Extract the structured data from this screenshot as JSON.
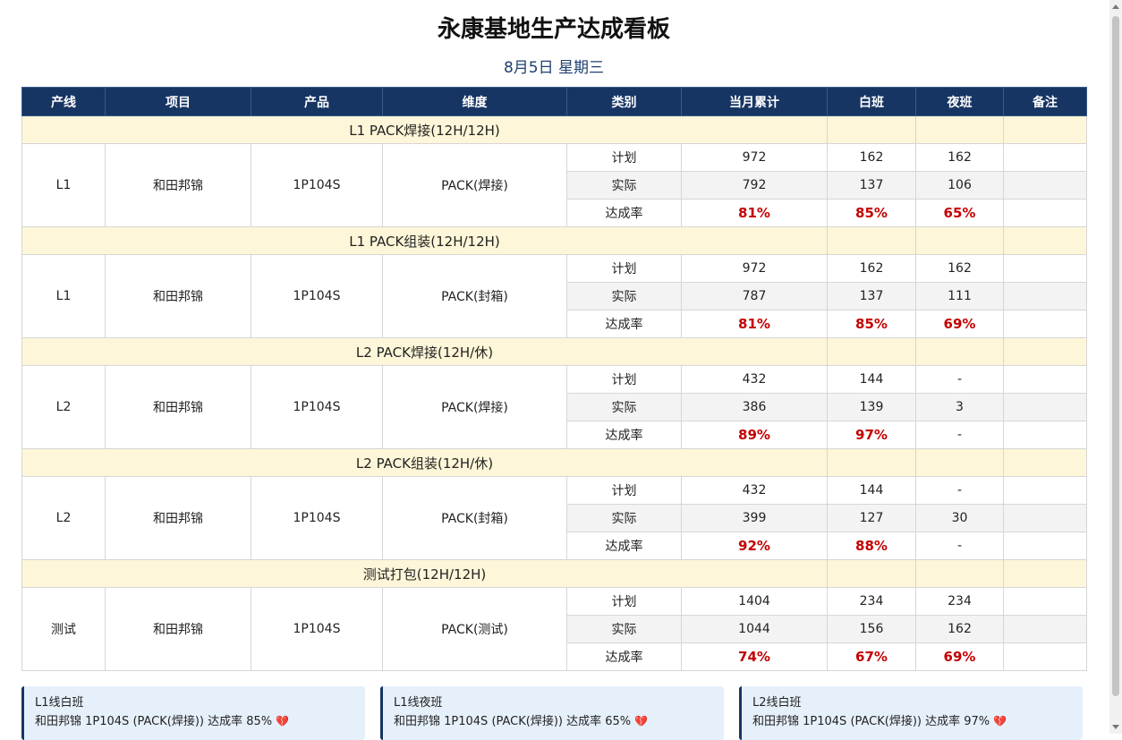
{
  "title": "永康基地生产达成看板",
  "date": "8月5日 星期三",
  "headers": [
    "产线",
    "项目",
    "产品",
    "维度",
    "类别",
    "当月累计",
    "白班",
    "夜班",
    "备注"
  ],
  "sections": [
    {
      "label": "L1 PACK焊接(12H/12H)",
      "line": "L1",
      "project": "和田邦锦",
      "product": "1P104S",
      "dimension": "PACK(焊接)",
      "rows": [
        {
          "category": "计划",
          "month": "972",
          "day": "162",
          "night": "162",
          "note": ""
        },
        {
          "category": "实际",
          "month": "792",
          "day": "137",
          "night": "106",
          "note": ""
        },
        {
          "category": "达成率",
          "month": "81%",
          "day": "85%",
          "night": "65%",
          "note": ""
        }
      ]
    },
    {
      "label": "L1 PACK组装(12H/12H)",
      "line": "L1",
      "project": "和田邦锦",
      "product": "1P104S",
      "dimension": "PACK(封箱)",
      "rows": [
        {
          "category": "计划",
          "month": "972",
          "day": "162",
          "night": "162",
          "note": ""
        },
        {
          "category": "实际",
          "month": "787",
          "day": "137",
          "night": "111",
          "note": ""
        },
        {
          "category": "达成率",
          "month": "81%",
          "day": "85%",
          "night": "69%",
          "note": ""
        }
      ]
    },
    {
      "label": "L2 PACK焊接(12H/休)",
      "line": "L2",
      "project": "和田邦锦",
      "product": "1P104S",
      "dimension": "PACK(焊接)",
      "rows": [
        {
          "category": "计划",
          "month": "432",
          "day": "144",
          "night": "-",
          "note": ""
        },
        {
          "category": "实际",
          "month": "386",
          "day": "139",
          "night": "3",
          "note": ""
        },
        {
          "category": "达成率",
          "month": "89%",
          "day": "97%",
          "night": "-",
          "note": ""
        }
      ]
    },
    {
      "label": "L2 PACK组装(12H/休)",
      "line": "L2",
      "project": "和田邦锦",
      "product": "1P104S",
      "dimension": "PACK(封箱)",
      "rows": [
        {
          "category": "计划",
          "month": "432",
          "day": "144",
          "night": "-",
          "note": ""
        },
        {
          "category": "实际",
          "month": "399",
          "day": "127",
          "night": "30",
          "note": ""
        },
        {
          "category": "达成率",
          "month": "92%",
          "day": "88%",
          "night": "-",
          "note": ""
        }
      ]
    },
    {
      "label": "测试打包(12H/12H)",
      "line": "测试",
      "project": "和田邦锦",
      "product": "1P104S",
      "dimension": "PACK(测试)",
      "rows": [
        {
          "category": "计划",
          "month": "1404",
          "day": "234",
          "night": "234",
          "note": ""
        },
        {
          "category": "实际",
          "month": "1044",
          "day": "156",
          "night": "162",
          "note": ""
        },
        {
          "category": "达成率",
          "month": "74%",
          "day": "67%",
          "night": "69%",
          "note": ""
        }
      ]
    }
  ],
  "cards": [
    {
      "title": "L1线白班",
      "text": "和田邦锦 1P104S (PACK(焊接)) 达成率 85%",
      "icon": "broken-heart-icon"
    },
    {
      "title": "L1线夜班",
      "text": "和田邦锦 1P104S (PACK(焊接)) 达成率 65%",
      "icon": "broken-heart-icon"
    },
    {
      "title": "L2线白班",
      "text": "和田邦锦 1P104S (PACK(焊接)) 达成率 97%",
      "icon": "broken-heart-icon"
    }
  ],
  "colors": {
    "header_bg": "#173563",
    "section_bg": "#fdf6d8",
    "rate": "#c40000",
    "card_bg": "#e6f0fb",
    "heart": "#e0457b"
  }
}
